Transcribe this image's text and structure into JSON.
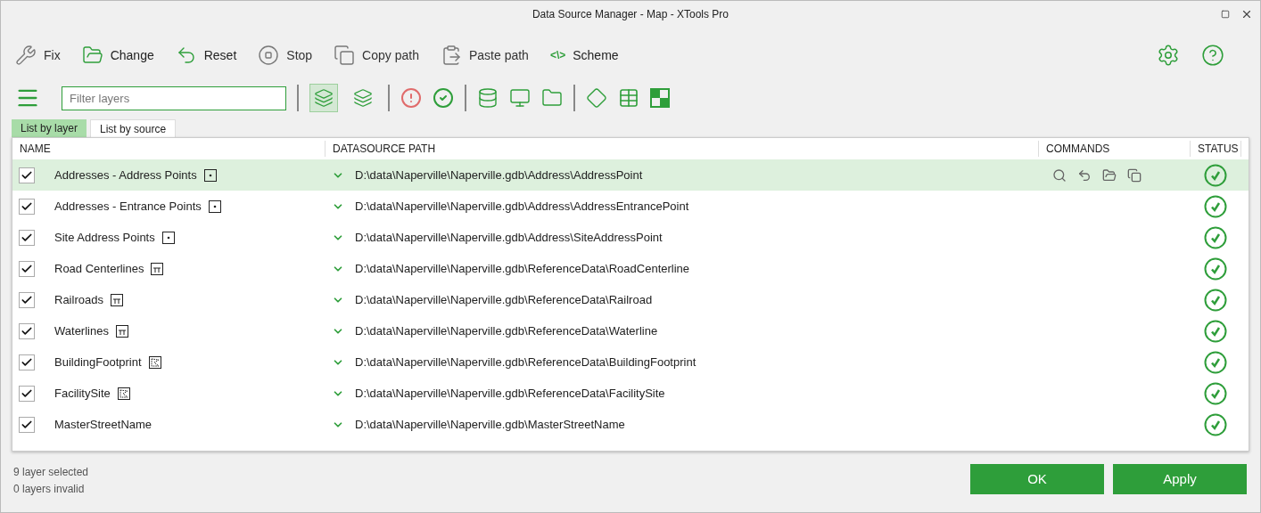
{
  "window": {
    "title": "Data Source Manager - Map  -  XTools Pro"
  },
  "toolbar": [
    {
      "label": "Fix",
      "disabled": true
    },
    {
      "label": "Change",
      "disabled": false
    },
    {
      "label": "Reset",
      "disabled": false
    },
    {
      "label": "Stop",
      "disabled": true
    },
    {
      "label": "Copy path",
      "disabled": true
    },
    {
      "label": "Paste path",
      "disabled": true
    },
    {
      "label": "Scheme",
      "disabled": false,
      "glyph": "<\\>"
    }
  ],
  "filter": {
    "placeholder": "Filter layers"
  },
  "view_toggles": [
    {
      "selected": true
    },
    {
      "selected": false
    }
  ],
  "tabs": [
    {
      "label": "List by layer",
      "selected": true
    },
    {
      "label": "List by source",
      "selected": false
    }
  ],
  "table": {
    "columns": [
      "NAME",
      "DATASOURCE PATH",
      "COMMANDS",
      "STATUS"
    ],
    "rows": [
      {
        "name": "Addresses - Address Points",
        "kind": "point",
        "path": "D:\\data\\Naperville\\Naperville.gdb\\Address\\AddressPoint",
        "checked": true,
        "selected": true,
        "valid": true
      },
      {
        "name": "Addresses - Entrance Points",
        "kind": "point",
        "path": "D:\\data\\Naperville\\Naperville.gdb\\Address\\AddressEntrancePoint",
        "checked": true,
        "selected": false,
        "valid": true
      },
      {
        "name": "Site Address Points",
        "kind": "point",
        "path": "D:\\data\\Naperville\\Naperville.gdb\\Address\\SiteAddressPoint",
        "checked": true,
        "selected": false,
        "valid": true
      },
      {
        "name": "Road Centerlines",
        "kind": "line",
        "path": "D:\\data\\Naperville\\Naperville.gdb\\ReferenceData\\RoadCenterline",
        "checked": true,
        "selected": false,
        "valid": true
      },
      {
        "name": "Railroads",
        "kind": "line",
        "path": "D:\\data\\Naperville\\Naperville.gdb\\ReferenceData\\Railroad",
        "checked": true,
        "selected": false,
        "valid": true
      },
      {
        "name": "Waterlines",
        "kind": "line",
        "path": "D:\\data\\Naperville\\Naperville.gdb\\ReferenceData\\Waterline",
        "checked": true,
        "selected": false,
        "valid": true
      },
      {
        "name": "BuildingFootprint",
        "kind": "polygon",
        "path": "D:\\data\\Naperville\\Naperville.gdb\\ReferenceData\\BuildingFootprint",
        "checked": true,
        "selected": false,
        "valid": true
      },
      {
        "name": "FacilitySite",
        "kind": "polygon",
        "path": "D:\\data\\Naperville\\Naperville.gdb\\ReferenceData\\FacilitySite",
        "checked": true,
        "selected": false,
        "valid": true
      },
      {
        "name": "MasterStreetName",
        "kind": "table",
        "path": "D:\\data\\Naperville\\Naperville.gdb\\MasterStreetName",
        "checked": true,
        "selected": false,
        "valid": true
      }
    ]
  },
  "status": [
    "9 layer selected",
    "0 layers invalid"
  ],
  "buttons": [
    "OK",
    "Apply"
  ]
}
